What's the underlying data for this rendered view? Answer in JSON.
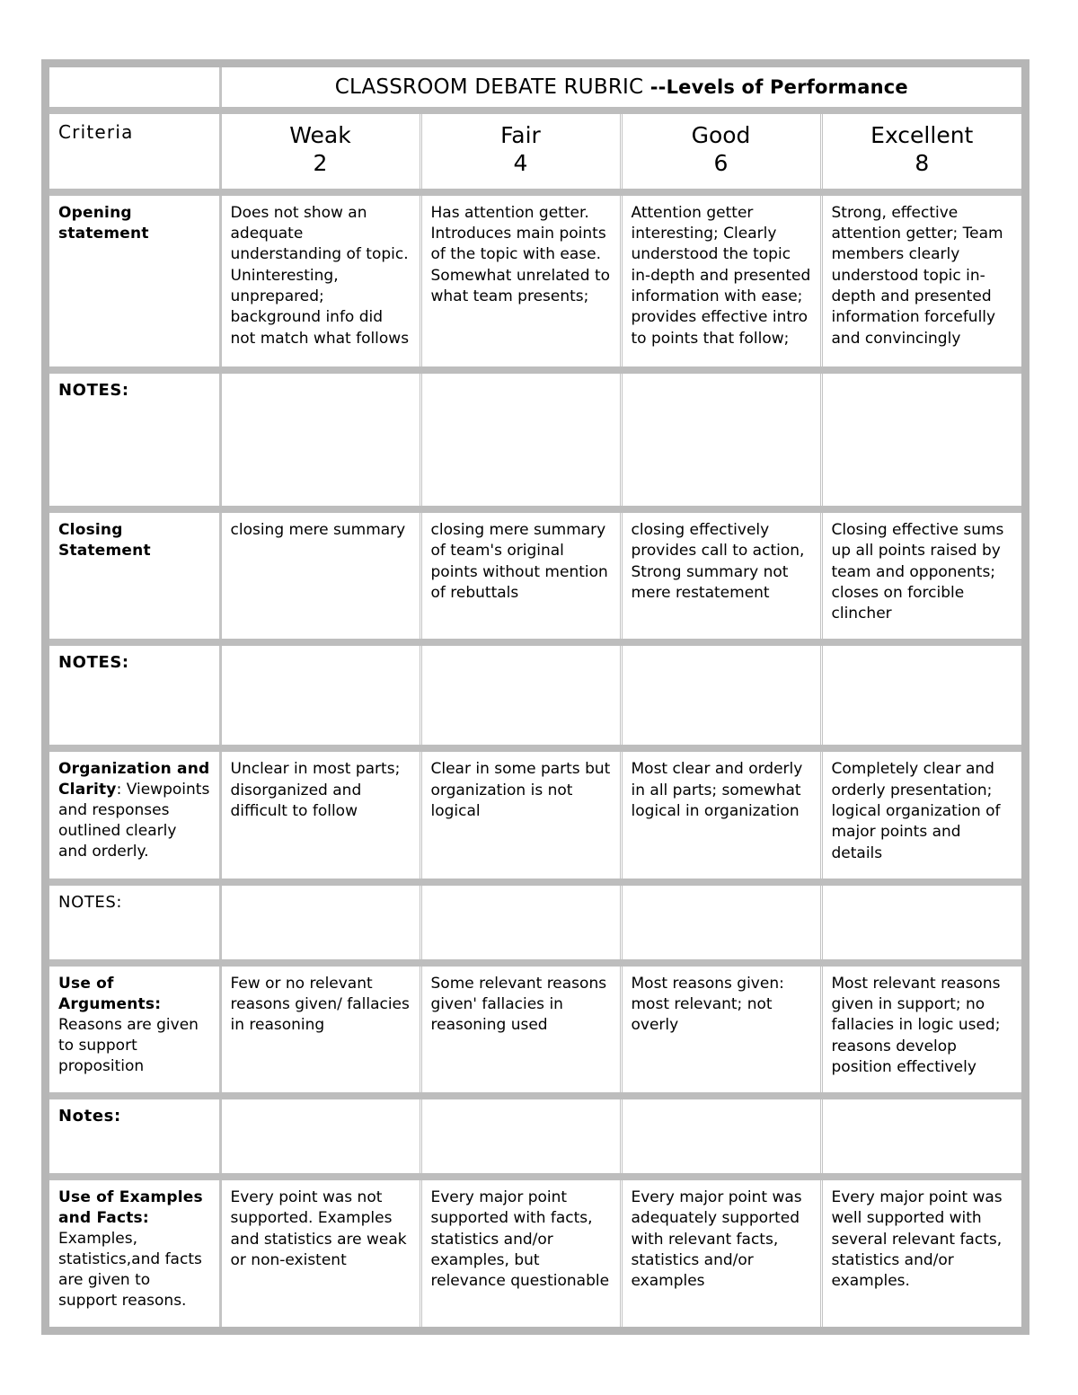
{
  "document": {
    "title_main": "CLASSROOM DEBATE RUBRIC ",
    "title_sub": "--Levels of Performance"
  },
  "table": {
    "criteria_header": "Criteria",
    "levels": [
      {
        "label": "Weak",
        "score": "2"
      },
      {
        "label": "Fair",
        "score": "4"
      },
      {
        "label": "Good",
        "score": "6"
      },
      {
        "label": "Excellent",
        "score": "8"
      }
    ],
    "rows": [
      {
        "type": "criterion",
        "criterion_title": "Opening statement",
        "criterion_desc": "",
        "cells": [
          "Does not show an adequate understanding of topic. Uninteresting, unprepared; background info did not match what follows",
          "Has attention getter. Introduces main points of the topic with ease. Somewhat unrelated to what team presents;",
          "Attention getter interesting; Clearly understood the topic in-depth and presented information with ease; provides effective intro to points that follow;",
          "Strong, effective attention getter; Team members clearly understood  topic in-depth and presented information forcefully and convincingly"
        ]
      },
      {
        "type": "notes",
        "label": "NOTES:",
        "bold": true,
        "cells": [
          "",
          "",
          "",
          ""
        ]
      },
      {
        "type": "criterion",
        "criterion_title": "Closing Statement",
        "criterion_desc": "",
        "cells": [
          "closing mere summary",
          "closing mere summary of team's original points without mention of rebuttals",
          "closing effectively provides call to action, Strong summary not mere restatement",
          "Closing effective sums up all points raised by team and opponents; closes on forcible clincher"
        ]
      },
      {
        "type": "notes",
        "label": "NOTES:",
        "bold": true,
        "cells": [
          "",
          "",
          "",
          ""
        ]
      },
      {
        "type": "criterion",
        "criterion_title": "Organization and Clarity",
        "criterion_desc": ": Viewpoints and responses outlined clearly and orderly.",
        "cells": [
          "Unclear in most parts; disorganized and difficult to follow",
          "Clear in some parts but organization is not logical",
          "Most clear and orderly in all parts; somewhat logical in organization",
          "Completely clear and orderly presentation; logical organization of major points and details"
        ]
      },
      {
        "type": "notes",
        "label": "NOTES:",
        "bold": false,
        "cells": [
          "",
          "",
          "",
          ""
        ]
      },
      {
        "type": "criterion",
        "criterion_title": " Use of Arguments:",
        "criterion_desc": "Reasons are given to support proposition",
        "cells": [
          "Few or no relevant reasons given/ fallacies in reasoning",
          "Some relevant reasons given' fallacies in reasoning used",
          "Most reasons given: most relevant; not overly",
          "Most relevant reasons given in support; no fallacies in logic used; reasons develop position effectively"
        ]
      },
      {
        "type": "notes",
        "label": "Notes:",
        "bold": true,
        "cells": [
          "",
          "",
          "",
          ""
        ]
      },
      {
        "type": "criterion",
        "criterion_title": "Use of Examples and Facts:",
        "criterion_desc": "Examples, statistics,and facts are given to support reasons.",
        "cells": [
          "Every point was not supported. Examples and statistics are weak or  non-existent",
          "Every major point supported with facts, statistics and/or examples, but relevance questionable",
          "Every major point was adequately supported with relevant facts, statistics and/or examples",
          "Every major point was well supported with several relevant facts, statistics and/or examples."
        ]
      }
    ]
  }
}
